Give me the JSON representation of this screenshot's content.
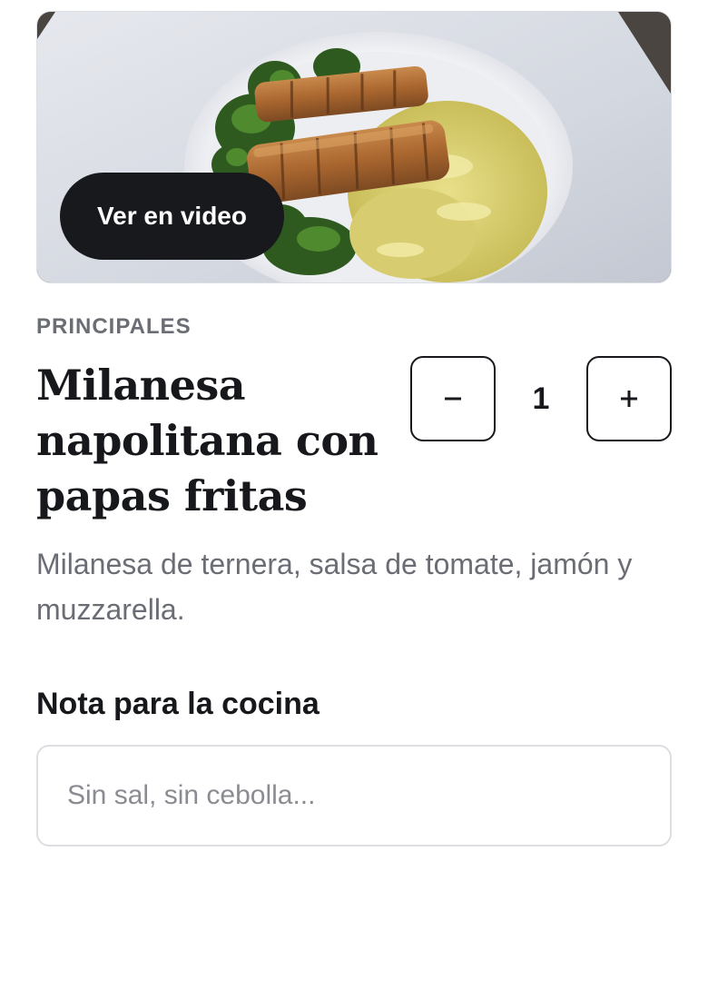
{
  "hero": {
    "video_button_label": "Ver en video"
  },
  "product": {
    "category": "PRINCIPALES",
    "title": "Milanesa napolitana con papas fritas",
    "description": "Milanesa de ternera, salsa de tomate, jamón y muzzarella."
  },
  "quantity": {
    "value": "1",
    "decrement_icon": "minus-icon",
    "increment_icon": "plus-icon"
  },
  "note": {
    "label": "Nota para la cocina",
    "placeholder": "Sin sal, sin cebolla...",
    "value": ""
  },
  "colors": {
    "primary_dark": "#18191d",
    "muted_text": "#6b6d75",
    "border": "#dcdee2"
  }
}
